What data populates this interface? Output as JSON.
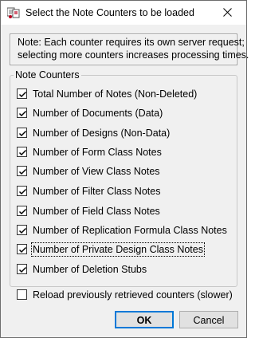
{
  "window": {
    "title": "Select the Note Counters to be loaded",
    "icon": "notes-app-icon",
    "close_icon": "close-icon"
  },
  "note": {
    "line1": "Note: Each counter requires its own server request;",
    "line2": "selecting more counters increases processing times."
  },
  "group": {
    "legend": "Note Counters",
    "items": [
      {
        "label": "Total Number of Notes (Non-Deleted)",
        "checked": true
      },
      {
        "label": "Number of Documents (Data)",
        "checked": true
      },
      {
        "label": "Number of Designs (Non-Data)",
        "checked": true
      },
      {
        "label": "Number of Form Class Notes",
        "checked": true
      },
      {
        "label": "Number of View Class Notes",
        "checked": true
      },
      {
        "label": "Number of Filter Class Notes",
        "checked": true
      },
      {
        "label": "Number of Field Class Notes",
        "checked": true
      },
      {
        "label": "Number of Replication Formula Class Notes",
        "checked": true
      },
      {
        "label": "Number of Private Design Class Notes",
        "checked": true
      },
      {
        "label": "Number of Deletion Stubs",
        "checked": true
      }
    ]
  },
  "reload": {
    "label": "Reload previously retrieved counters (slower)",
    "checked": false
  },
  "buttons": {
    "ok": "OK",
    "cancel": "Cancel"
  },
  "colors": {
    "accent": "#0078d7",
    "checkbox_fill": "#ffffff"
  }
}
